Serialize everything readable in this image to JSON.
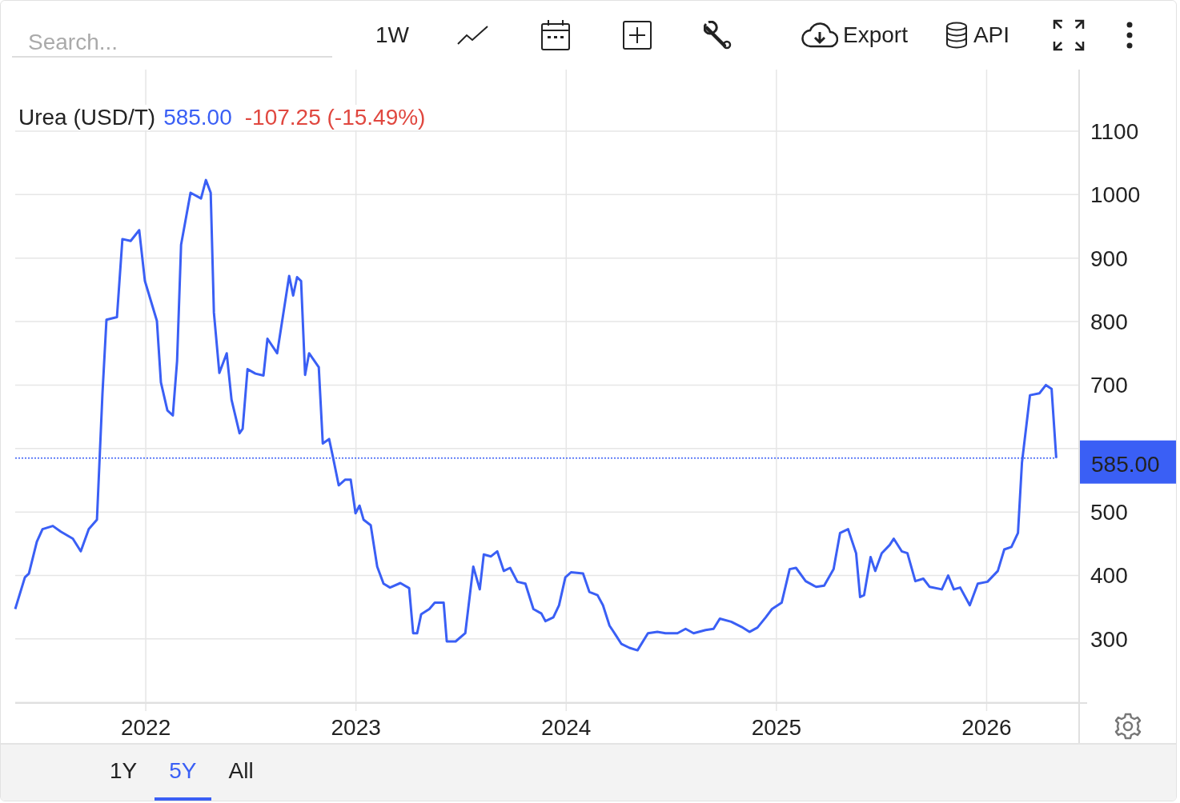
{
  "toolbar": {
    "search": {
      "placeholder": "Search..."
    },
    "interval": "1W",
    "export": "Export",
    "api": "API"
  },
  "legend": {
    "price": "585.00",
    "change": "-107.25 (-15.49%)"
  },
  "chart_data": {
    "type": "line",
    "x": [
      2021.379,
      2021.425,
      2021.444,
      2021.482,
      2021.509,
      2021.558,
      2021.596,
      2021.653,
      2021.691,
      2021.729,
      2021.768,
      2021.794,
      2021.813,
      2021.863,
      2021.889,
      2021.928,
      2021.969,
      2021.996,
      2022.053,
      2022.072,
      2022.103,
      2022.129,
      2022.149,
      2022.168,
      2022.213,
      2022.263,
      2022.286,
      2022.309,
      2022.324,
      2022.35,
      2022.385,
      2022.408,
      2022.446,
      2022.461,
      2022.484,
      2022.522,
      2022.56,
      2022.579,
      2022.625,
      2022.682,
      2022.701,
      2022.72,
      2022.739,
      2022.758,
      2022.777,
      2022.823,
      2022.842,
      2022.872,
      2022.891,
      2022.918,
      2022.949,
      2022.975,
      2022.998,
      2023.017,
      2023.036,
      2023.07,
      2023.101,
      2023.131,
      2023.162,
      2023.211,
      2023.253,
      2023.272,
      2023.291,
      2023.31,
      2023.349,
      2023.375,
      2023.417,
      2023.432,
      2023.474,
      2023.52,
      2023.558,
      2023.589,
      2023.608,
      2023.642,
      2023.672,
      2023.703,
      2023.733,
      2023.768,
      2023.806,
      2023.844,
      2023.882,
      2023.901,
      2023.939,
      2023.966,
      2023.996,
      2024.023,
      2024.08,
      2024.11,
      2024.149,
      2024.175,
      2024.206,
      2024.236,
      2024.263,
      2024.301,
      2024.339,
      2024.389,
      2024.434,
      2024.472,
      2024.529,
      2024.568,
      2024.606,
      2024.663,
      2024.701,
      2024.731,
      2024.785,
      2024.834,
      2024.872,
      2024.91,
      2024.949,
      2024.979,
      2025.025,
      2025.063,
      2025.093,
      2025.139,
      2025.189,
      2025.227,
      2025.272,
      2025.303,
      2025.341,
      2025.379,
      2025.398,
      2025.417,
      2025.448,
      2025.47,
      2025.501,
      2025.539,
      2025.558,
      2025.596,
      2025.623,
      2025.661,
      2025.699,
      2025.729,
      2025.787,
      2025.817,
      2025.844,
      2025.874,
      2025.92,
      2025.958,
      2026.004,
      2026.053,
      2026.084,
      2026.118,
      2026.149,
      2026.168,
      2026.206,
      2026.251,
      2026.282,
      2026.309,
      2026.331
    ],
    "series": [
      {
        "name": "Urea (USD/T)",
        "color": "#3a5ff5",
        "values": [
          347,
          397,
          403,
          453,
          473,
          478,
          469,
          458,
          438,
          473,
          488,
          687,
          803,
          807,
          930,
          927,
          944,
          864,
          801,
          704,
          660,
          652,
          738,
          921,
          1003,
          994,
          1023,
          1003,
          814,
          719,
          750,
          677,
          624,
          631,
          725,
          718,
          715,
          773,
          750,
          872,
          841,
          870,
          864,
          716,
          750,
          728,
          608,
          615,
          586,
          542,
          551,
          551,
          498,
          510,
          488,
          479,
          414,
          387,
          381,
          388,
          380,
          309,
          309,
          339,
          347,
          357,
          357,
          296,
          296,
          309,
          414,
          378,
          433,
          430,
          438,
          407,
          412,
          390,
          387,
          347,
          340,
          328,
          334,
          353,
          397,
          405,
          403,
          374,
          369,
          353,
          321,
          306,
          292,
          286,
          282,
          309,
          311,
          309,
          309,
          316,
          309,
          314,
          316,
          332,
          327,
          319,
          311,
          318,
          334,
          347,
          357,
          410,
          412,
          391,
          382,
          384,
          410,
          467,
          473,
          435,
          366,
          369,
          429,
          407,
          435,
          448,
          458,
          438,
          435,
          391,
          395,
          382,
          378,
          400,
          378,
          381,
          353,
          387,
          390,
          407,
          441,
          445,
          467,
          578,
          684,
          687,
          700,
          694,
          585
        ]
      }
    ],
    "xlim": [
      2021.379,
      2026.44
    ],
    "ylim": [
      199,
      1197
    ],
    "xticks": [
      2022,
      2023,
      2024,
      2025,
      2026
    ],
    "yticks": [
      300,
      400,
      500,
      700,
      800,
      900,
      1000,
      1100
    ],
    "grid": true,
    "ref_lines": [
      {
        "axis": "y",
        "value": 585,
        "label": "585.00",
        "color": "#3a5ff5"
      }
    ]
  },
  "range_tabs": [
    {
      "label": "1Y",
      "selected": false
    },
    {
      "label": "5Y",
      "selected": true
    },
    {
      "label": "All",
      "selected": false
    }
  ]
}
